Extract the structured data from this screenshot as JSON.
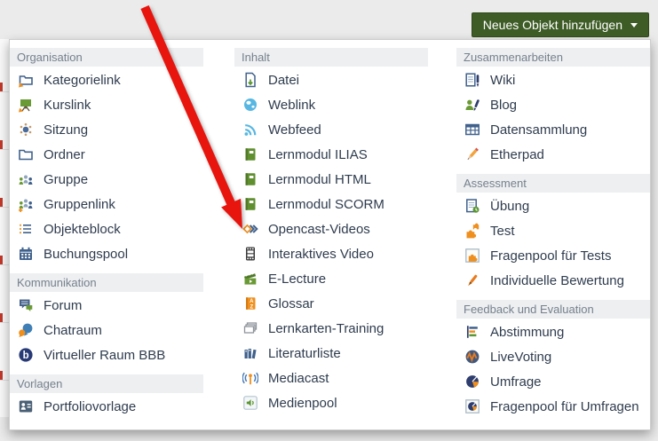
{
  "toolbar": {
    "add_button_label": "Neues Objekt hinzufügen",
    "add_button_color": "#3e5c26",
    "caret_icon": "caret-down-icon"
  },
  "annotation": {
    "arrow_color": "#e8140e",
    "arrow_points_to": "Opencast-Videos"
  },
  "menu": {
    "columns": [
      {
        "sections": [
          {
            "header": "Organisation",
            "items": [
              {
                "label": "Kategorielink",
                "icon": "category-link-icon"
              },
              {
                "label": "Kurslink",
                "icon": "course-link-icon"
              },
              {
                "label": "Sitzung",
                "icon": "session-icon"
              },
              {
                "label": "Ordner",
                "icon": "folder-icon"
              },
              {
                "label": "Gruppe",
                "icon": "group-icon"
              },
              {
                "label": "Gruppenlink",
                "icon": "group-link-icon"
              },
              {
                "label": "Objekteblock",
                "icon": "item-block-icon"
              },
              {
                "label": "Buchungspool",
                "icon": "booking-pool-icon"
              }
            ]
          },
          {
            "header": "Kommunikation",
            "items": [
              {
                "label": "Forum",
                "icon": "forum-icon"
              },
              {
                "label": "Chatraum",
                "icon": "chatroom-icon"
              },
              {
                "label": "Virtueller Raum BBB",
                "icon": "bbb-icon"
              }
            ]
          },
          {
            "header": "Vorlagen",
            "items": [
              {
                "label": "Portfoliovorlage",
                "icon": "portfolio-template-icon"
              }
            ]
          }
        ]
      },
      {
        "sections": [
          {
            "header": "Inhalt",
            "items": [
              {
                "label": "Datei",
                "icon": "file-icon"
              },
              {
                "label": "Weblink",
                "icon": "weblink-icon"
              },
              {
                "label": "Webfeed",
                "icon": "webfeed-icon"
              },
              {
                "label": "Lernmodul ILIAS",
                "icon": "learning-module-icon"
              },
              {
                "label": "Lernmodul HTML",
                "icon": "learning-module-icon"
              },
              {
                "label": "Lernmodul SCORM",
                "icon": "learning-module-icon"
              },
              {
                "label": "Opencast-Videos",
                "icon": "opencast-icon"
              },
              {
                "label": "Interaktives Video",
                "icon": "interactive-video-icon"
              },
              {
                "label": "E-Lecture",
                "icon": "e-lecture-icon"
              },
              {
                "label": "Glossar",
                "icon": "glossary-icon"
              },
              {
                "label": "Lernkarten-Training",
                "icon": "flashcards-icon"
              },
              {
                "label": "Literaturliste",
                "icon": "bibliography-icon"
              },
              {
                "label": "Mediacast",
                "icon": "mediacast-icon"
              },
              {
                "label": "Medienpool",
                "icon": "media-pool-icon"
              }
            ]
          }
        ]
      },
      {
        "sections": [
          {
            "header": "Zusammenarbeiten",
            "items": [
              {
                "label": "Wiki",
                "icon": "wiki-icon"
              },
              {
                "label": "Blog",
                "icon": "blog-icon"
              },
              {
                "label": "Datensammlung",
                "icon": "data-collection-icon"
              },
              {
                "label": "Etherpad",
                "icon": "etherpad-icon"
              }
            ]
          },
          {
            "header": "Assessment",
            "items": [
              {
                "label": "Übung",
                "icon": "exercise-icon"
              },
              {
                "label": "Test",
                "icon": "test-icon"
              },
              {
                "label": "Fragenpool für Tests",
                "icon": "question-pool-test-icon"
              },
              {
                "label": "Individuelle Bewertung",
                "icon": "individual-assessment-icon"
              }
            ]
          },
          {
            "header": "Feedback und Evaluation",
            "items": [
              {
                "label": "Abstimmung",
                "icon": "poll-icon"
              },
              {
                "label": "LiveVoting",
                "icon": "live-voting-icon"
              },
              {
                "label": "Umfrage",
                "icon": "survey-icon"
              },
              {
                "label": "Fragenpool für Umfragen",
                "icon": "question-pool-survey-icon"
              }
            ]
          }
        ]
      }
    ]
  }
}
